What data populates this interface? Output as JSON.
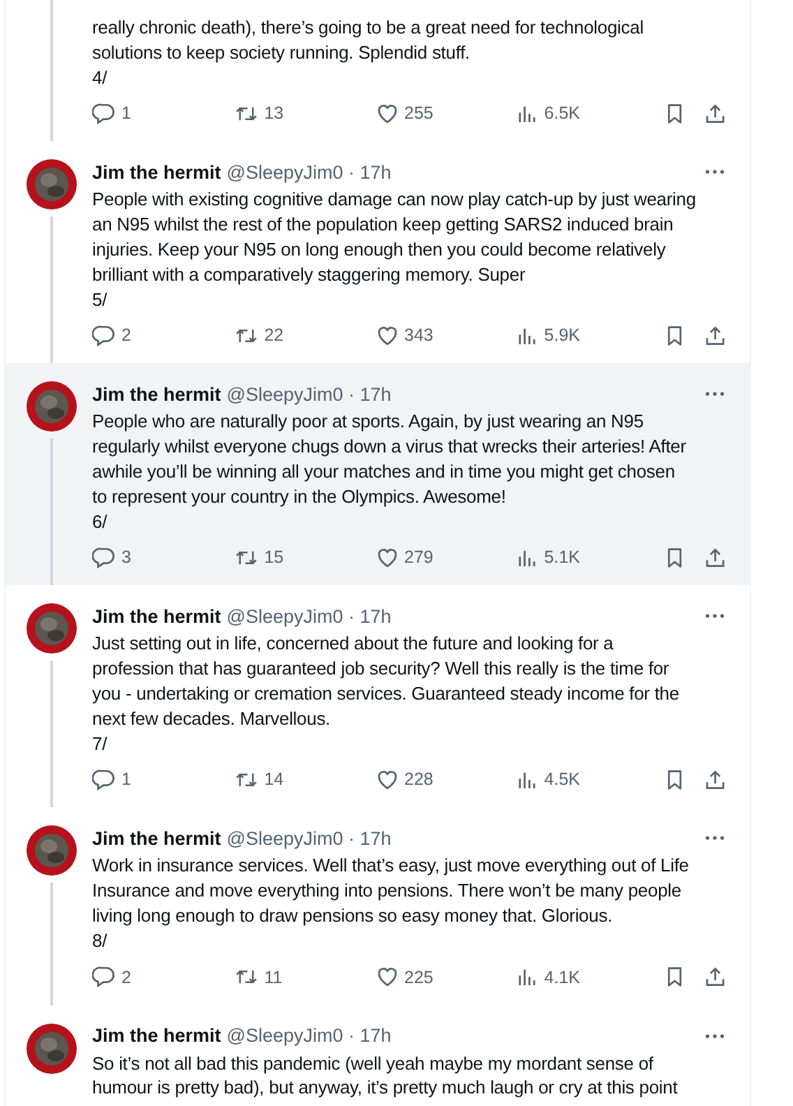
{
  "tweets": [
    {
      "highlighted": false,
      "text": "really chronic death), there’s going to be a great need for technological\nsolutions to keep society running. Splendid stuff.\n4/",
      "replies": "1",
      "reposts": "13",
      "likes": "255",
      "views": "6.5K"
    },
    {
      "highlighted": false,
      "author": "Jim the hermit",
      "meta": "@SleepyJim0 · 17h",
      "text": "People with existing cognitive damage can now play catch-up by just wearing\nan N95 whilst the rest of the population keep getting SARS2 induced brain\ninjuries. Keep your N95 on long enough then you could become relatively\nbrilliant with a comparatively staggering memory. Super\n5/",
      "replies": "2",
      "reposts": "22",
      "likes": "343",
      "views": "5.9K"
    },
    {
      "highlighted": true,
      "author": "Jim the hermit",
      "meta": "@SleepyJim0 · 17h",
      "text": "People who are naturally poor at sports. Again, by just wearing an N95\nregularly whilst everyone chugs down a virus that wrecks their arteries! After\nawhile you’ll be winning all your matches and in time you might get chosen\nto represent your country in the Olympics. Awesome!\n6/",
      "replies": "3",
      "reposts": "15",
      "likes": "279",
      "views": "5.1K"
    },
    {
      "highlighted": false,
      "author": "Jim the hermit",
      "meta": "@SleepyJim0 · 17h",
      "text": "Just setting out in life, concerned about the future and looking for a\nprofession that has guaranteed job security? Well this really is the time for\nyou - undertaking or cremation services. Guaranteed steady income for the\nnext few decades. Marvellous.\n7/",
      "replies": "1",
      "reposts": "14",
      "likes": "228",
      "views": "4.5K"
    },
    {
      "highlighted": false,
      "author": "Jim the hermit",
      "meta": "@SleepyJim0 · 17h",
      "text": "Work in insurance services. Well that’s easy, just move everything out of Life\nInsurance and move everything into pensions. There won’t be many people\nliving long enough to draw pensions so easy money that. Glorious.\n8/",
      "replies": "2",
      "reposts": "11",
      "likes": "225",
      "views": "4.1K"
    },
    {
      "highlighted": false,
      "author": "Jim the hermit",
      "meta": "@SleepyJim0 · 17h",
      "text": "So it’s not all bad this pandemic (well yeah maybe my mordant sense of\nhumour is pretty bad), but anyway, it’s pretty much laugh or cry at this point"
    }
  ]
}
